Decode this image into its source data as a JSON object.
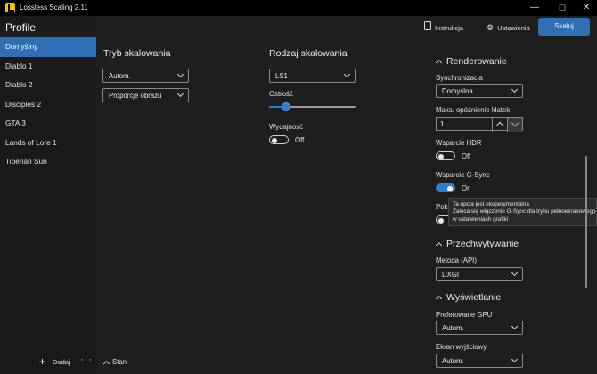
{
  "window": {
    "title": "Lossless Scaling 2.11",
    "controls": {
      "minimize": "—",
      "maximize": "☐",
      "close": "✕"
    }
  },
  "sidebar": {
    "header": "Profile",
    "items": [
      {
        "label": "Domyślny",
        "active": true
      },
      {
        "label": "Diablo 1"
      },
      {
        "label": "Diablo 2"
      },
      {
        "label": "Disciples 2"
      },
      {
        "label": "GTA 3"
      },
      {
        "label": "Lands of Lore 1"
      },
      {
        "label": "Tiberian Sun"
      }
    ],
    "footer": {
      "add_icon": "+",
      "add_label": "Dodaj",
      "more_icon": "···"
    }
  },
  "header": {
    "instrukcja": "Instrukcja",
    "ustawienia": "Ustawienia",
    "skaluj": "Skaluj",
    "accent": "#2f6fb3"
  },
  "scaling_mode": {
    "title": "Tryb skalowania",
    "mode": "Autom.",
    "aspect": "Proporcje obrazu"
  },
  "scaling_type": {
    "title": "Rodzaj skalowania",
    "type": "LS1",
    "sharpness_label": "Ostrość",
    "sharpness_value": 0.2,
    "performance_label": "Wydajność",
    "performance_state": "Off"
  },
  "rendering": {
    "title": "Renderowanie",
    "sync_label": "Synchronizacja",
    "sync_value": "Domyślna",
    "max_latency_label": "Maks. opóźnienie klatek",
    "max_latency_value": "1",
    "hdr_label": "Wsparcie HDR",
    "hdr_state": "Off",
    "gsync_label": "Wsparcie G-Sync",
    "gsync_state": "On",
    "partial_label": "Pok",
    "tooltip": [
      "Ta opcja jest eksperymentalna",
      "Zaleca się włączenie G-Sync dla trybu pełnoekranowego",
      "w ustawieniach grafiki"
    ]
  },
  "capture": {
    "title": "Przechwytywanie",
    "method_label": "Metoda (API)",
    "method_value": "DXGI"
  },
  "display": {
    "title": "Wyświetlanie",
    "gpu_label": "Preferowane GPU",
    "gpu_value": "Autom.",
    "output_label": "Ekran wyjściowy",
    "output_value": "Autom."
  },
  "footer": {
    "stan": "Stan"
  }
}
